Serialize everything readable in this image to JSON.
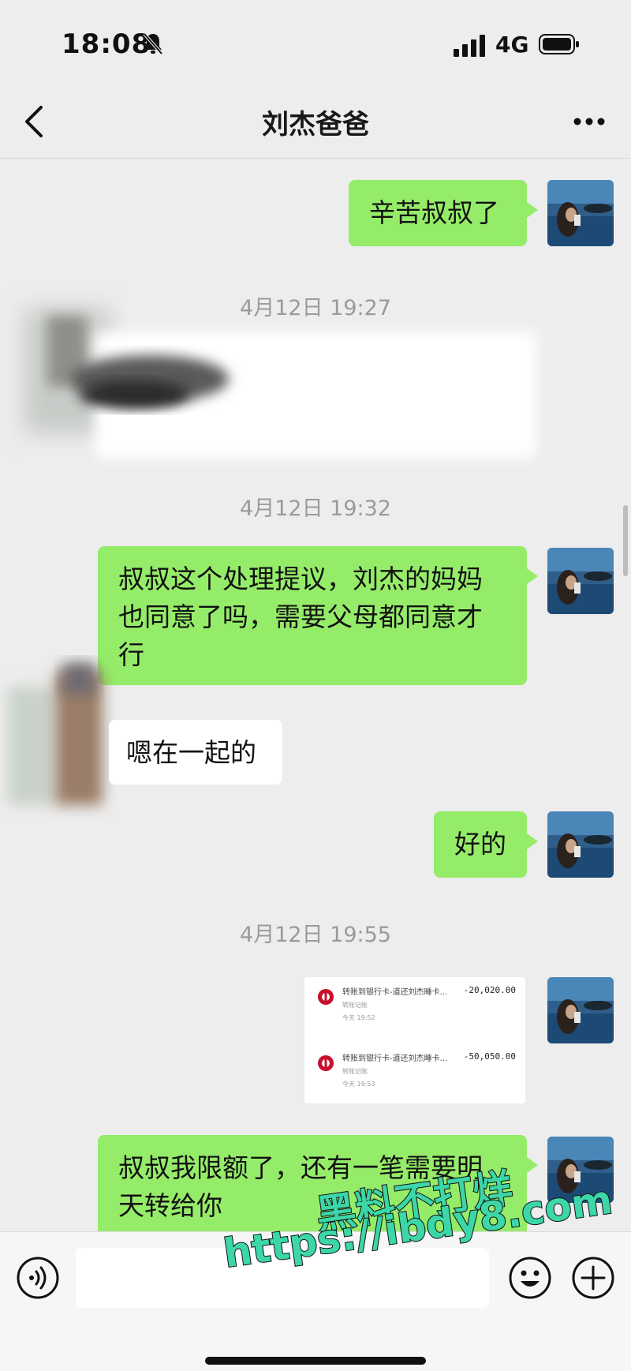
{
  "status_bar": {
    "time": "18:08",
    "network": "4G"
  },
  "header": {
    "title": "刘杰爸爸"
  },
  "messages": {
    "m1": "辛苦叔叔了",
    "ts1": "4月12日 19:27",
    "ts2": "4月12日 19:32",
    "m2": "叔叔这个处理提议，刘杰的妈妈也同意了吗，需要父母都同意才行",
    "m3": "嗯在一起的",
    "m4": "好的",
    "ts3": "4月12日 19:55",
    "m5": "叔叔我限额了，还有一笔需要明天转给你"
  },
  "transfers": [
    {
      "title": "转账到银行卡-道还刘杰睡卡...",
      "subtitle": "转账记账",
      "time": "今天 19:52",
      "amount": "-20,020.00"
    },
    {
      "title": "转账到银行卡-道还刘杰睡卡...",
      "subtitle": "转账记账",
      "time": "今天 19:53",
      "amount": "-50,050.00"
    }
  ],
  "watermark": {
    "line1": "黑料不打烊",
    "line2": "https://ibdy8.com"
  },
  "colors": {
    "my_bubble": "#95ec69",
    "their_bubble": "#ffffff",
    "background": "#ededed"
  },
  "icons": [
    "bell-off-icon",
    "signal-icon",
    "battery-icon",
    "back-icon",
    "more-icon",
    "voice-icon",
    "emoji-icon",
    "plus-icon"
  ]
}
